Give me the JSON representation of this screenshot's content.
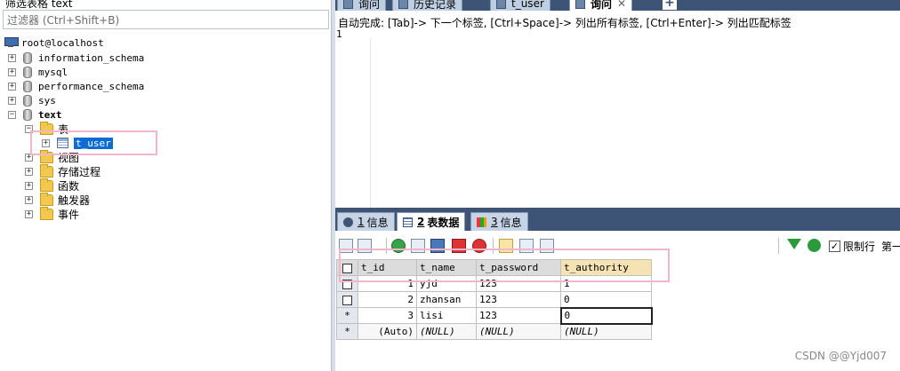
{
  "left_panel": {
    "title": "筛选表格 text",
    "filter_placeholder": "过滤器 (Ctrl+Shift+B)",
    "root": "root@localhost",
    "databases": [
      {
        "name": "information_schema"
      },
      {
        "name": "mysql"
      },
      {
        "name": "performance_schema"
      },
      {
        "name": "sys"
      },
      {
        "name": "text"
      }
    ],
    "text_db": {
      "tables_folder": "表",
      "table": "t_user",
      "folders": [
        "视图",
        "存储过程",
        "函数",
        "触发器",
        "事件"
      ]
    }
  },
  "query_tabs": [
    {
      "label": "询问",
      "active": false
    },
    {
      "label": "历史记录",
      "active": false
    },
    {
      "label": "t_user",
      "active": false
    },
    {
      "label": "询问",
      "active": true,
      "close": "✕"
    }
  ],
  "add_tab": "+",
  "editor": {
    "hint": "自动完成: [Tab]-> 下一个标签, [Ctrl+Space]-> 列出所有标签, [Ctrl+Enter]-> 列出匹配标签",
    "line_number": "1"
  },
  "result_tabs": [
    {
      "num": "1",
      "label": "信息",
      "active": false
    },
    {
      "num": "2",
      "label": "表数据",
      "active": true
    },
    {
      "num": "3",
      "label": "信息",
      "active": false
    }
  ],
  "toolbar": {
    "limit_rows": "限制行",
    "first": "第一",
    "limit_checked": "✓"
  },
  "grid": {
    "columns": [
      "t_id",
      "t_name",
      "t_password",
      "t_authority"
    ],
    "rows": [
      {
        "marker": "",
        "t_id": "1",
        "t_name": "yjd",
        "t_password": "123",
        "t_authority": "1"
      },
      {
        "marker": "",
        "t_id": "2",
        "t_name": "zhansan",
        "t_password": "123",
        "t_authority": "0"
      },
      {
        "marker": "*",
        "t_id": "3",
        "t_name": "lisi",
        "t_password": "123",
        "t_authority": "0"
      },
      {
        "marker": "*",
        "t_id": "(Auto)",
        "t_name": "(NULL)",
        "t_password": "(NULL)",
        "t_authority": "(NULL)"
      }
    ]
  },
  "watermark": "CSDN @@Yjd007"
}
